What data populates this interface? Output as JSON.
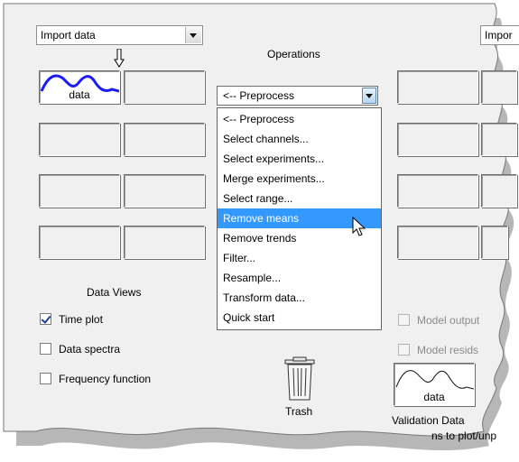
{
  "left_import": {
    "value": "Import data"
  },
  "right_import": {
    "value": "Impor"
  },
  "operations": {
    "title": "Operations",
    "preprocess_value": "<-- Preprocess",
    "menu_items": [
      "<-- Preprocess",
      "Select channels...",
      "Select experiments...",
      "Merge experiments...",
      "Select range...",
      "Remove means",
      "Remove trends",
      "Filter...",
      "Resample...",
      "Transform data...",
      "Quick start"
    ],
    "highlighted_item": "Remove means"
  },
  "data_board": {
    "active_tile_label": "data",
    "title": "Data Views"
  },
  "data_views": [
    {
      "label": "Time plot",
      "checked": true
    },
    {
      "label": "Data spectra",
      "checked": false
    },
    {
      "label": "Frequency function",
      "checked": false
    }
  ],
  "model_views": [
    {
      "label": "Model output",
      "checked": false,
      "enabled": false
    },
    {
      "label": "Model resids",
      "checked": false,
      "enabled": false
    }
  ],
  "trash": {
    "label": "Trash"
  },
  "validation": {
    "tile_label": "data",
    "caption": "Validation Data"
  },
  "footer_hint": "ns to plot/unp",
  "colors": {
    "signal": "#1a1aff",
    "highlight": "#3399ff"
  }
}
